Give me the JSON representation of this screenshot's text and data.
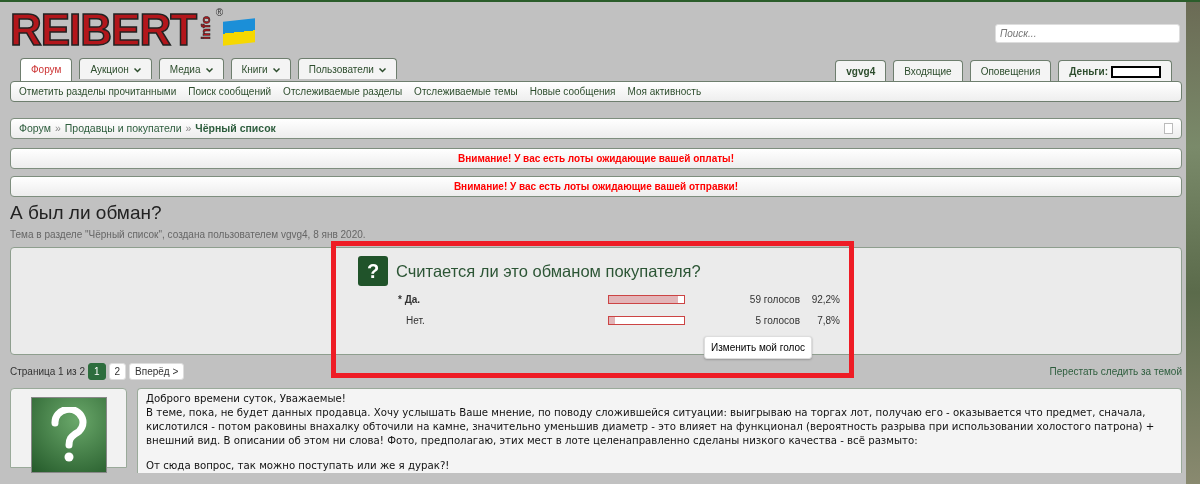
{
  "logo": {
    "text": "REIBERT",
    "suffix": "info",
    "mark": "®"
  },
  "search": {
    "placeholder": "Поиск..."
  },
  "tabs": [
    {
      "label": "Форум",
      "selected": true,
      "dropdown": false
    },
    {
      "label": "Аукцион",
      "selected": false,
      "dropdown": true
    },
    {
      "label": "Медиа",
      "selected": false,
      "dropdown": true
    },
    {
      "label": "Книги",
      "selected": false,
      "dropdown": true
    },
    {
      "label": "Пользователи",
      "selected": false,
      "dropdown": true
    }
  ],
  "user_tabs": [
    {
      "label": "vgvg4",
      "kind": "user"
    },
    {
      "label": "Входящие",
      "kind": "link"
    },
    {
      "label": "Оповещения",
      "kind": "link"
    },
    {
      "label": "Деньги:",
      "kind": "money"
    }
  ],
  "sub_nav": [
    "Отметить разделы прочитанными",
    "Поиск сообщений",
    "Отслеживаемые разделы",
    "Отслеживаемые темы",
    "Новые сообщения",
    "Моя активность"
  ],
  "breadcrumb": [
    {
      "label": "Форум",
      "current": false
    },
    {
      "label": "Продавцы и покупатели",
      "current": false
    },
    {
      "label": "Чёрный список",
      "current": true
    }
  ],
  "breadcrumb_separator": "»",
  "alerts": [
    "Внимание! У вас есть лоты ожидающие вашей оплаты!",
    "Внимание! У вас есть лоты ожидающие вашей отправки!"
  ],
  "thread": {
    "title": "А был ли обман?",
    "meta": "Тема в разделе \"Чёрный список\", создана пользователем vgvg4, 8 янв 2020."
  },
  "poll": {
    "icon_text": "?",
    "question": "Считается ли это обманом покупателя?",
    "options": [
      {
        "label": "* Да.",
        "voted": true,
        "level": 0.922,
        "votes": "59 голосов",
        "percent": "92,2%"
      },
      {
        "label": "Нет.",
        "voted": false,
        "level": 0.078,
        "votes": "5 голосов",
        "percent": "7,8%"
      }
    ],
    "button": "Изменить мой голос"
  },
  "pagination": {
    "label": "Страница 1 из 2",
    "pages": [
      {
        "label": "1",
        "selected": true
      },
      {
        "label": "2",
        "selected": false
      }
    ],
    "next": "Вперёд >"
  },
  "unwatch": "Перестать следить за темой",
  "post": {
    "paragraphs": [
      "Доброго времени суток, Уважаемые!",
      "В теме, пока, не будет данных продавца. Хочу услышать Ваше мнение, по поводу сложившейся ситуации: выигрываю на торгах лот, получаю его - оказывается что предмет, сначала, кислотился - потом раковины внахалку обточили на камне, значительно уменьшив диаметр - это влияет на функционал (вероятность разрыва при использовании холостого патрона) + внешний вид. В описании об этом ни слова! Фото, предполагаю, этих мест в лоте целенаправленно сделаны низкого качества - всё размыто:",
      "От сюда вопрос, так можно поступать или же я дурак?!"
    ]
  }
}
